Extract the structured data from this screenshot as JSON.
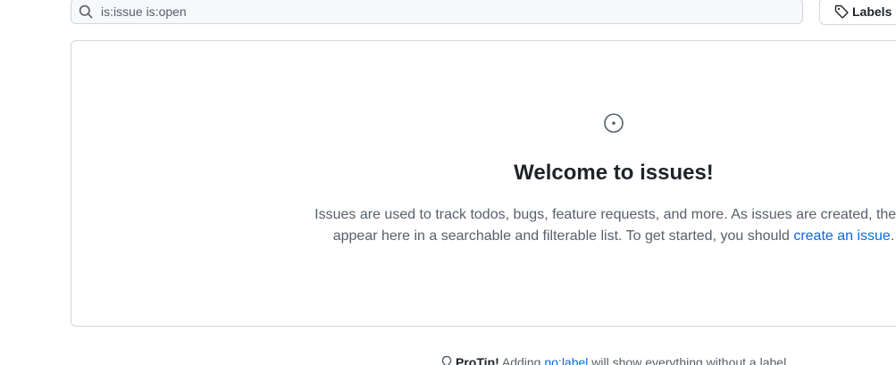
{
  "search": {
    "value": "is:issue is:open",
    "icon": "search-icon"
  },
  "filters": {
    "labels_label": "Labels",
    "labels_icon": "tag-icon"
  },
  "blankslate": {
    "icon": "issue-opened-icon",
    "title": "Welcome to issues!",
    "description_before": "Issues are used to track todos, bugs, feature requests, and more. As issues are created, they’ll appear here in a searchable and filterable list. To get started, you should ",
    "link": "create an issue",
    "description_after": "."
  },
  "protip": {
    "icon": "light-bulb-icon",
    "strong": "ProTip!",
    "text_before": " Adding ",
    "link": "no:label",
    "text_after": " will show everything without a label."
  },
  "colors": {
    "border": "#d0d7de",
    "muted_text": "#57606a",
    "link": "#0969da",
    "text": "#1f2328",
    "input_bg": "#f6f8fa"
  }
}
